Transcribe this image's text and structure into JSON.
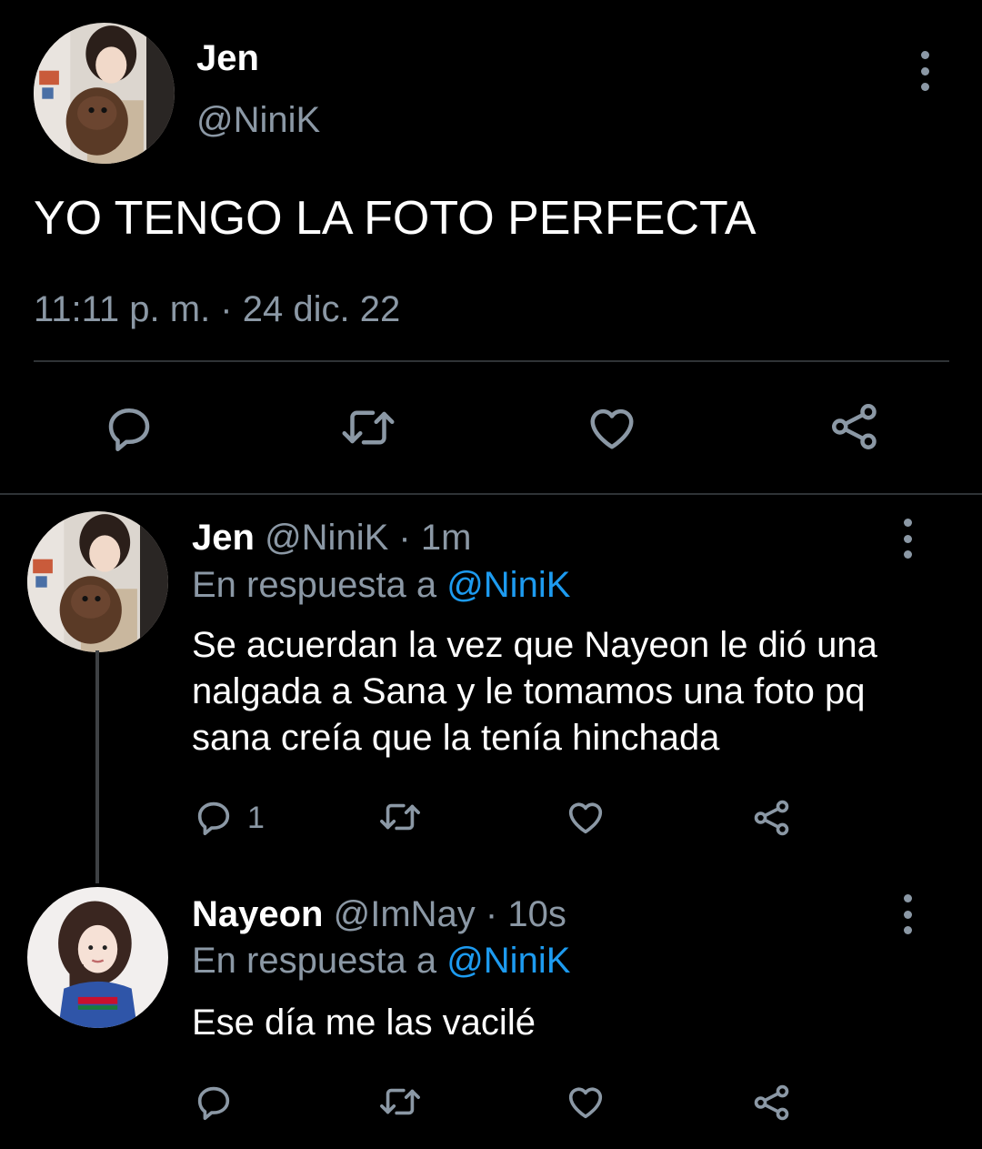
{
  "main_tweet": {
    "name": "Jen",
    "handle": "@NiniK",
    "text": "YO TENGO LA FOTO PERFECTA",
    "timestamp": "11:11 p. m. · 24 dic. 22",
    "actions": [
      "reply-icon",
      "retweet-icon",
      "like-icon",
      "share-icon"
    ]
  },
  "replies": [
    {
      "name": "Jen",
      "handle": "@NiniK",
      "separator": "·",
      "time": "1m",
      "reply_to_prefix": "En respuesta a",
      "reply_to_handle": "@NiniK",
      "text": "Se acuerdan la vez que Nayeon le dió una nalgada a Sana y le tomamos una foto pq sana creía que la tenía hinchada",
      "reply_count": "1"
    },
    {
      "name": "Nayeon",
      "handle": "@ImNay",
      "separator": "·",
      "time": "10s",
      "reply_to_prefix": "En respuesta a",
      "reply_to_handle": "@NiniK",
      "text": "Ese día me las vacilé",
      "reply_count": ""
    }
  ],
  "colors": {
    "background": "#000000",
    "text_primary": "#ffffff",
    "text_secondary": "#8b98a5",
    "link": "#1d9bf0",
    "divider": "#2f3336"
  }
}
